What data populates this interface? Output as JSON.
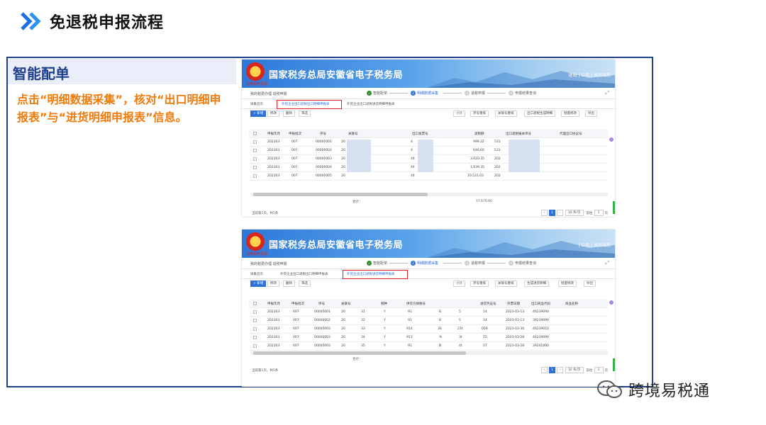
{
  "slide": {
    "title": "免退税申报流程",
    "section_title": "智能配单",
    "description": "点击“明细数据采集”，核对“出口明细申报表”与“进货明细申报表”信息。",
    "watermark": "跨境易税通"
  },
  "app": {
    "banner_title": "国家税务总局安徽省电子税务局",
    "banner_caption": "国家税务总局",
    "links1": "退出 | 公司 | 关闭当前",
    "links2": "| 公司 | 关闭当前",
    "breadcrumb": "我的税费办理 退税申报",
    "steps": [
      "智能配单",
      "明细数据采集",
      "退税申报",
      "申报结果查询"
    ],
    "expand_icon": "expand-icon"
  },
  "screen1": {
    "tabs": [
      "采集首页",
      "外贸企业出口退税出口明细申报表",
      "外贸企业出口退税进货明细申报表"
    ],
    "toolbar_left": [
      "+ 新增",
      "修改",
      "删除",
      "筛选"
    ],
    "toolbar_right": [
      "小计",
      "序号重排",
      "关联号重排",
      "出口退税生成明细",
      "批量修改",
      "导出"
    ],
    "columns": [
      "申报年月",
      "申报批次",
      "序号",
      "关联号",
      "出口发票号",
      "退税额",
      "出口退税报关单号",
      "代理出口协议号"
    ],
    "rows": [
      [
        "202303",
        "007",
        "00000001",
        "20",
        "4",
        "999.32",
        "531"
      ],
      [
        "202303",
        "007",
        "00000002",
        "20",
        "4",
        "640.60",
        "531"
      ],
      [
        "202303",
        "007",
        "00000003",
        "20",
        "44",
        "3,610.35",
        "202"
      ],
      [
        "202303",
        "007",
        "00000004",
        "20",
        "44",
        "1,639.35",
        "202"
      ],
      [
        "202303",
        "007",
        "00000005",
        "20",
        "44",
        "10,531.03",
        "202"
      ]
    ],
    "total_label": "合计：",
    "total_value": "17,670.66",
    "page_info": "当前第1页，共5条",
    "page_current": "1",
    "page_size": "10 条/页",
    "jump_label": "前往",
    "jump_value": "1",
    "page_unit": "页"
  },
  "screen2": {
    "tabs": [
      "采集首页",
      "外贸企业出口退税出口明细申报表",
      "外贸企业出口退税进货明细申报表"
    ],
    "toolbar_left": [
      "+ 新增",
      "修改",
      "删除",
      "筛选"
    ],
    "toolbar_right": [
      "小计",
      "序号重排",
      "关联号重排",
      "生成进货明细",
      "批量修改",
      "导出"
    ],
    "columns": [
      "申报年月",
      "申报批次",
      "序号",
      "关联号",
      "税种",
      "供货方纳税号",
      "",
      "",
      "进货凭证号",
      "开票日期",
      "出口商品代码",
      "商品名称"
    ],
    "rows": [
      [
        "202303",
        "007",
        "00000001",
        "20",
        "31",
        "Y",
        "91",
        "B",
        "5",
        "14",
        "2023-03-13",
        "46239090"
      ],
      [
        "202303",
        "007",
        "00000002",
        "20",
        "32",
        "Y",
        "91",
        "B",
        "5",
        "14",
        "2023-03-13",
        "39239090"
      ],
      [
        "202303",
        "007",
        "00000003",
        "20",
        "33",
        "Y",
        "914",
        "36",
        "23t",
        "009",
        "2023-03-30",
        "46239010"
      ],
      [
        "202303",
        "007",
        "00000003",
        "20",
        "34",
        "Y",
        "913",
        "%",
        "3t",
        "55",
        "2023-03-28",
        "46239090"
      ],
      [
        "202303",
        "007",
        "00000003",
        "20",
        "35",
        "Y",
        "91",
        "N",
        "4t",
        "07",
        "2023-03-28",
        "39241000"
      ]
    ],
    "total_label": "合计：",
    "page_info": "当前第1页，共5条",
    "page_current": "1",
    "page_size": "10 条/页",
    "jump_label": "前往",
    "jump_value": "1",
    "page_unit": "页"
  }
}
